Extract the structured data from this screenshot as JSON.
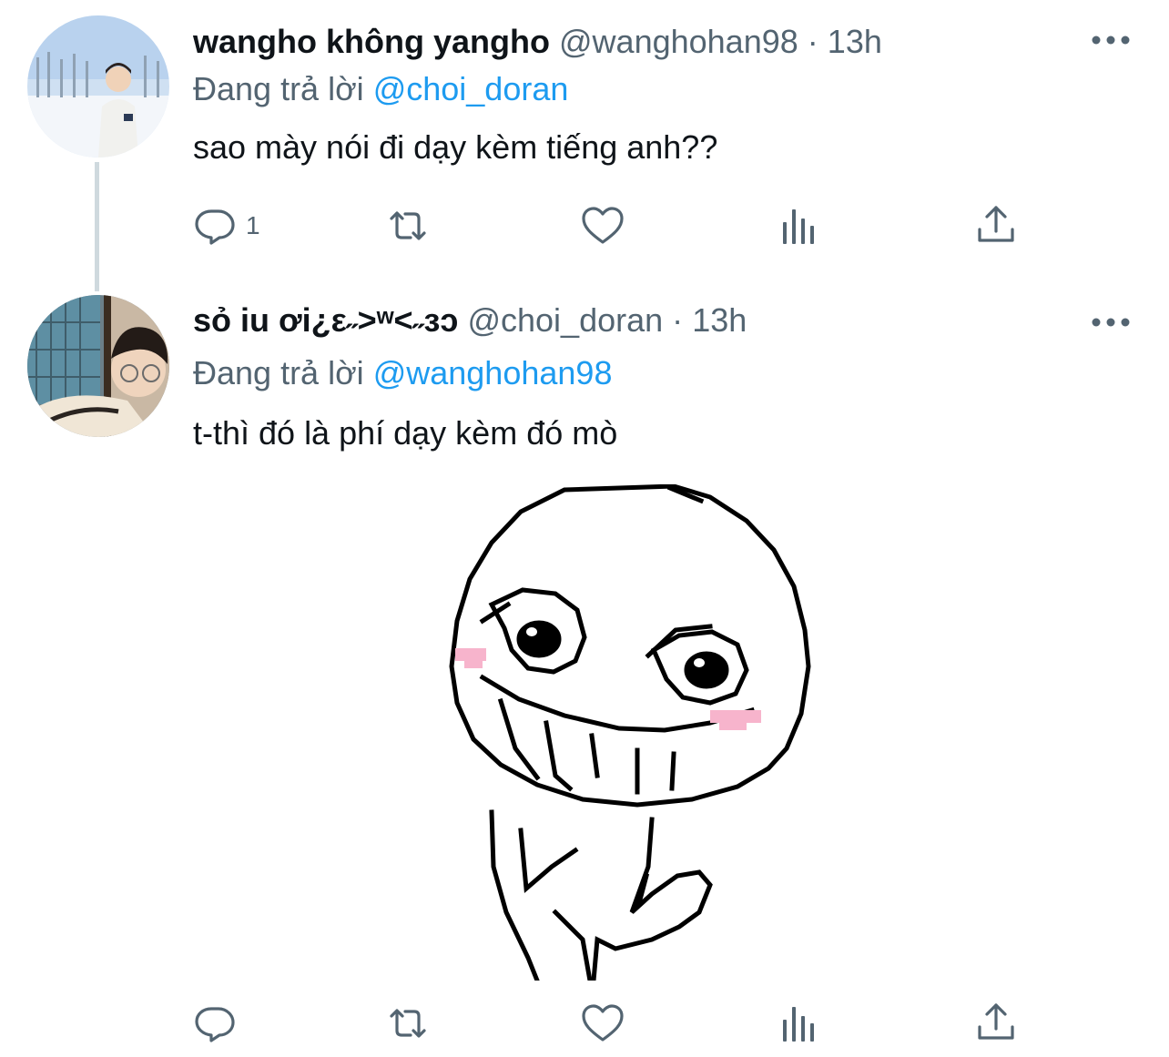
{
  "tweets": [
    {
      "name": "wangho không yangho",
      "handle": "@wanghohan98",
      "separator": "·",
      "time": "13h",
      "replying_prefix": "Đang trả lời",
      "replying_to": "@choi_doran",
      "text": "sao mày nói đi dạy kèm tiếng anh??",
      "reply_count": "1"
    },
    {
      "name": "sỏ iu ơi¿ε˶>ʷ<˶зɔ",
      "handle": "@choi_doran",
      "separator": "·",
      "time": "13h",
      "replying_prefix": "Đang trả lời",
      "replying_to": "@wanghohan98",
      "text": "t-thì đó là phí dạy kèm đó mò",
      "reply_count": ""
    }
  ],
  "colors": {
    "accent": "#1d9bf0",
    "secondary_text": "#536471",
    "thread_line": "#cfd9de",
    "blush": "#f7b4cc"
  },
  "icons": [
    "reply-icon",
    "retweet-icon",
    "like-icon",
    "views-icon",
    "share-icon",
    "more-icon"
  ]
}
